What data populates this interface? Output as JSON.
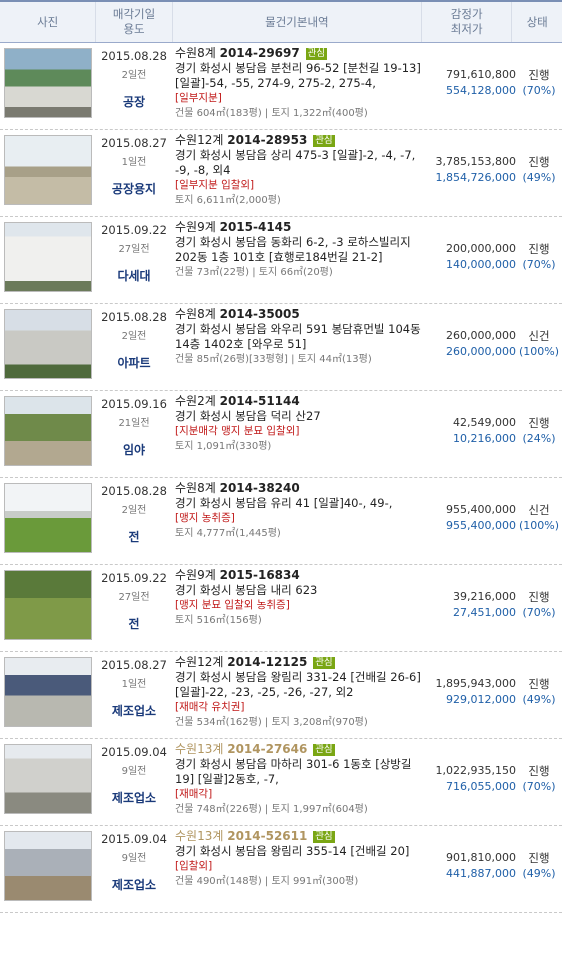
{
  "header": {
    "photo": "사진",
    "date_line1": "매각기일",
    "date_line2": "용도",
    "info": "물건기본내역",
    "price_line1": "감정가",
    "price_line2": "최저가",
    "status": "상태"
  },
  "rows": [
    {
      "date": "2015.08.28",
      "ago": "2일전",
      "use": "공장",
      "court": "수원8계",
      "case": "2014-29697",
      "tag": "관심",
      "addr": "경기 화성시 봉담읍 분천리 96-52 [분천길 19-13] [일괄]-54, -55, 274-9, 275-2, 275-4,",
      "warn": "[일부지분]",
      "area": "건물 604㎡(183평) | 토지 1,322㎡(400평)",
      "appraisal": "791,610,800",
      "minimum": "554,128,000",
      "status": "진행",
      "rate": "(70%)",
      "muted": false
    },
    {
      "date": "2015.08.27",
      "ago": "1일전",
      "use": "공장용지",
      "court": "수원12계",
      "case": "2014-28953",
      "tag": "관심",
      "addr": "경기 화성시 봉담읍 상리 475-3 [일괄]-2, -4, -7, -9, -8, 외4",
      "warn": "[일부지분 입찰외]",
      "area": "토지 6,611㎡(2,000평)",
      "appraisal": "3,785,153,800",
      "minimum": "1,854,726,000",
      "status": "진행",
      "rate": "(49%)",
      "muted": false
    },
    {
      "date": "2015.09.22",
      "ago": "27일전",
      "use": "다세대",
      "court": "수원9계",
      "case": "2015-4145",
      "tag": "",
      "addr": "경기 화성시 봉담읍 동화리 6-2, -3 로하스빌리지 202동 1층 101호 [효행로184번길 21-2]",
      "warn": "",
      "area": "건물 73㎡(22평) | 토지 66㎡(20평)",
      "appraisal": "200,000,000",
      "minimum": "140,000,000",
      "status": "진행",
      "rate": "(70%)",
      "muted": false
    },
    {
      "date": "2015.08.28",
      "ago": "2일전",
      "use": "아파트",
      "court": "수원8계",
      "case": "2014-35005",
      "tag": "",
      "addr": "경기 화성시 봉담읍 와우리 591 봉담휴먼빌 104동 14층 1402호 [와우로 51]",
      "warn": "",
      "area": "건물 85㎡(26평)[33평형] | 토지 44㎡(13평)",
      "appraisal": "260,000,000",
      "minimum": "260,000,000",
      "status": "신건",
      "rate": "(100%)",
      "muted": false
    },
    {
      "date": "2015.09.16",
      "ago": "21일전",
      "use": "임야",
      "court": "수원2계",
      "case": "2014-51144",
      "tag": "",
      "addr": "경기 화성시 봉담읍 덕리 산27",
      "warn": "[지분매각 맹지 분묘 입찰외]",
      "area": "토지 1,091㎡(330평)",
      "appraisal": "42,549,000",
      "minimum": "10,216,000",
      "status": "진행",
      "rate": "(24%)",
      "muted": false
    },
    {
      "date": "2015.08.28",
      "ago": "2일전",
      "use": "전",
      "court": "수원8계",
      "case": "2014-38240",
      "tag": "",
      "addr": "경기 화성시 봉담읍 유리 41 [일괄]40-, 49-,",
      "warn": "[맹지 농취증]",
      "area": "토지 4,777㎡(1,445평)",
      "appraisal": "955,400,000",
      "minimum": "955,400,000",
      "status": "신건",
      "rate": "(100%)",
      "muted": false
    },
    {
      "date": "2015.09.22",
      "ago": "27일전",
      "use": "전",
      "court": "수원9계",
      "case": "2015-16834",
      "tag": "",
      "addr": "경기 화성시 봉담읍 내리 623",
      "warn": "[맹지 분묘 입찰외 농취증]",
      "area": "토지 516㎡(156평)",
      "appraisal": "39,216,000",
      "minimum": "27,451,000",
      "status": "진행",
      "rate": "(70%)",
      "muted": false
    },
    {
      "date": "2015.08.27",
      "ago": "1일전",
      "use": "제조업소",
      "court": "수원12계",
      "case": "2014-12125",
      "tag": "관심",
      "addr": "경기 화성시 봉담읍 왕림리 331-24 [건배길 26-6] [일괄]-22, -23, -25, -26, -27, 외2",
      "warn": "[재매각 유치권]",
      "area": "건물 534㎡(162평) | 토지 3,208㎡(970평)",
      "appraisal": "1,895,943,000",
      "minimum": "929,012,000",
      "status": "진행",
      "rate": "(49%)",
      "muted": false
    },
    {
      "date": "2015.09.04",
      "ago": "9일전",
      "use": "제조업소",
      "court": "수원13계",
      "case": "2014-27646",
      "tag": "관심",
      "addr": "경기 화성시 봉담읍 마하리 301-6 1동호 [상방길 19] [일괄]2동호, -7,",
      "warn": "[재매각]",
      "area": "건물 748㎡(226평) | 토지 1,997㎡(604평)",
      "appraisal": "1,022,935,150",
      "minimum": "716,055,000",
      "status": "진행",
      "rate": "(70%)",
      "muted": true
    },
    {
      "date": "2015.09.04",
      "ago": "9일전",
      "use": "제조업소",
      "court": "수원13계",
      "case": "2014-52611",
      "tag": "관심",
      "addr": "경기 화성시 봉담읍 왕림리 355-14 [건배길 20]",
      "warn": "[입찰외]",
      "area": "건물 490㎡(148평) | 토지 991㎡(300평)",
      "appraisal": "901,810,000",
      "minimum": "441,887,000",
      "status": "진행",
      "rate": "(49%)",
      "muted": true
    }
  ]
}
